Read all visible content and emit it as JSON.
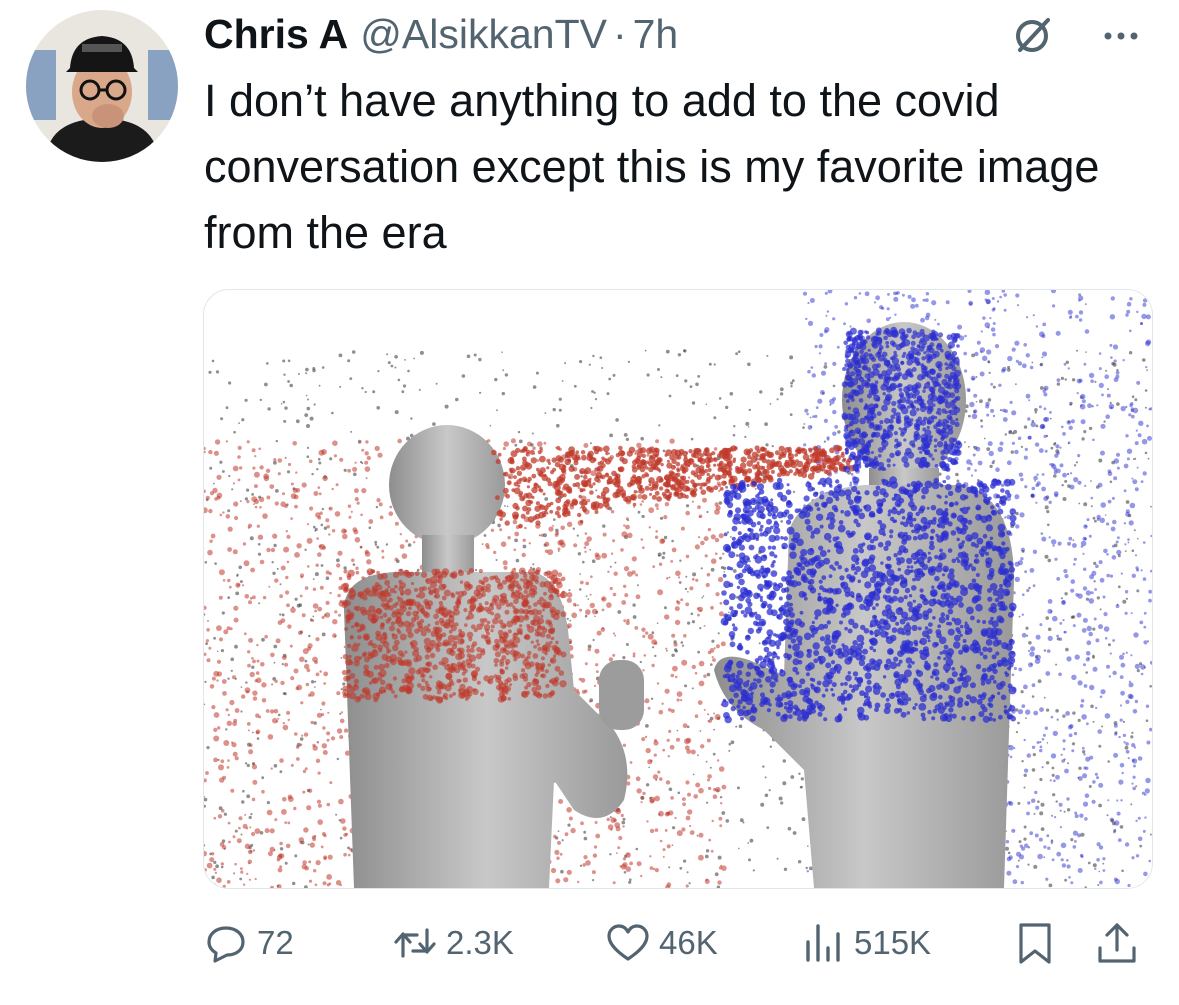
{
  "author": {
    "display_name": "Chris A",
    "handle": "@AlsikkanTV",
    "separator": "·",
    "time_ago": "7h"
  },
  "tweet": {
    "text": "I don’t have anything to add to the covid conversation except this is my favorite image from the era"
  },
  "media": {
    "description_colors": {
      "red_spray": "#c0392b",
      "blue_spray": "#2c2fd0",
      "figure": "#a9a9a9"
    }
  },
  "metrics": {
    "replies": "72",
    "reposts": "2.3K",
    "likes": "46K",
    "views": "515K"
  },
  "icons": {
    "reply": "reply-bubble-icon",
    "repost": "repost-arrows-icon",
    "like": "heart-icon",
    "views": "bar-chart-icon",
    "bookmark": "bookmark-icon",
    "share": "share-upload-icon",
    "grok": "slashed-circle-icon",
    "more": "ellipsis-icon"
  },
  "colors": {
    "text_primary": "#0f1419",
    "text_secondary": "#536471"
  }
}
